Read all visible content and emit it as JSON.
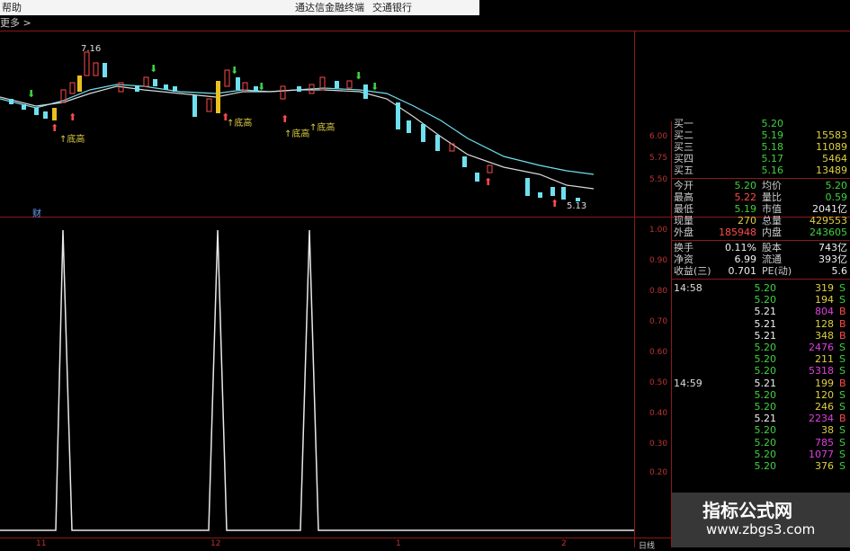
{
  "titlebar": {
    "menu": "帮助",
    "title": "通达信金融终端",
    "stock_name": "交通银行"
  },
  "subbar": {
    "more": "更多 >"
  },
  "price_axis": [
    "6.00",
    "5.75",
    "5.50"
  ],
  "indicator_axis": [
    "1.00",
    "0.90",
    "0.80",
    "0.70",
    "0.60",
    "0.50",
    "0.40",
    "0.30",
    "0.20"
  ],
  "annotations": {
    "high_price": "7.16",
    "low_price": "5.13",
    "bottom_high": "↑底高",
    "finance_tag": "财"
  },
  "bottom_bar": {
    "dates": [
      "11",
      "12",
      "1",
      "2"
    ],
    "period": "日线"
  },
  "quote": {
    "bids": [
      {
        "label": "买一",
        "price": "5.20",
        "vol": "",
        "price_color": "green"
      },
      {
        "label": "买二",
        "price": "5.19",
        "vol": "15583",
        "price_color": "green"
      },
      {
        "label": "买三",
        "price": "5.18",
        "vol": "11089",
        "price_color": "green"
      },
      {
        "label": "买四",
        "price": "5.17",
        "vol": "5464",
        "price_color": "green"
      },
      {
        "label": "买五",
        "price": "5.16",
        "vol": "13489",
        "price_color": "green"
      }
    ],
    "stats": [
      {
        "l1": "今开",
        "v1": "5.20",
        "c1": "green",
        "l2": "均价",
        "v2": "5.20",
        "c2": "green"
      },
      {
        "l1": "最高",
        "v1": "5.22",
        "c1": "red",
        "l2": "量比",
        "v2": "0.59",
        "c2": "green"
      },
      {
        "l1": "最低",
        "v1": "5.19",
        "c1": "green",
        "l2": "市值",
        "v2": "2041亿",
        "c2": "white"
      },
      {
        "l1": "现量",
        "v1": "270",
        "c1": "yellow",
        "l2": "总量",
        "v2": "429553",
        "c2": "yellow"
      },
      {
        "l1": "外盘",
        "v1": "185948",
        "c1": "red",
        "l2": "内盘",
        "v2": "243605",
        "c2": "green"
      }
    ],
    "fin": [
      {
        "l1": "换手",
        "v1": "0.11%",
        "l2": "股本",
        "v2": "743亿"
      },
      {
        "l1": "净资",
        "v1": "6.99",
        "l2": "流通",
        "v2": "393亿"
      },
      {
        "l1": "收益(三)",
        "v1": "0.701",
        "l2": "PE(动)",
        "v2": "5.6"
      }
    ],
    "ticks": [
      {
        "time": "14:58",
        "price": "5.20",
        "pc": "green",
        "vol": "319",
        "vc": "yellow",
        "bs": "S",
        "bsc": "green"
      },
      {
        "time": "",
        "price": "5.20",
        "pc": "green",
        "vol": "194",
        "vc": "yellow",
        "bs": "S",
        "bsc": "green"
      },
      {
        "time": "",
        "price": "5.21",
        "pc": "white",
        "vol": "804",
        "vc": "magenta",
        "bs": "B",
        "bsc": "red"
      },
      {
        "time": "",
        "price": "5.21",
        "pc": "white",
        "vol": "128",
        "vc": "yellow",
        "bs": "B",
        "bsc": "red"
      },
      {
        "time": "",
        "price": "5.21",
        "pc": "white",
        "vol": "348",
        "vc": "yellow",
        "bs": "B",
        "bsc": "red"
      },
      {
        "time": "",
        "price": "5.20",
        "pc": "green",
        "vol": "2476",
        "vc": "magenta",
        "bs": "S",
        "bsc": "green"
      },
      {
        "time": "",
        "price": "5.20",
        "pc": "green",
        "vol": "211",
        "vc": "yellow",
        "bs": "S",
        "bsc": "green"
      },
      {
        "time": "",
        "price": "5.20",
        "pc": "green",
        "vol": "5318",
        "vc": "magenta",
        "bs": "S",
        "bsc": "green"
      },
      {
        "time": "14:59",
        "price": "5.21",
        "pc": "white",
        "vol": "199",
        "vc": "yellow",
        "bs": "B",
        "bsc": "red"
      },
      {
        "time": "",
        "price": "5.20",
        "pc": "green",
        "vol": "120",
        "vc": "yellow",
        "bs": "S",
        "bsc": "green"
      },
      {
        "time": "",
        "price": "5.20",
        "pc": "green",
        "vol": "246",
        "vc": "yellow",
        "bs": "S",
        "bsc": "green"
      },
      {
        "time": "",
        "price": "5.21",
        "pc": "white",
        "vol": "2234",
        "vc": "magenta",
        "bs": "B",
        "bsc": "red"
      },
      {
        "time": "",
        "price": "5.20",
        "pc": "green",
        "vol": "38",
        "vc": "yellow",
        "bs": "S",
        "bsc": "green"
      },
      {
        "time": "",
        "price": "5.20",
        "pc": "green",
        "vol": "785",
        "vc": "magenta",
        "bs": "S",
        "bsc": "green"
      },
      {
        "time": "",
        "price": "5.20",
        "pc": "green",
        "vol": "1077",
        "vc": "magenta",
        "bs": "S",
        "bsc": "green"
      },
      {
        "time": "",
        "price": "5.20",
        "pc": "green",
        "vol": "376",
        "vc": "yellow",
        "bs": "S",
        "bsc": "green"
      }
    ]
  },
  "watermark": {
    "title": "指标公式网",
    "url": "www.zbgs3.com"
  },
  "colors": {
    "up": "#ff4b4b",
    "down": "#3fd23f",
    "cyan": "#6fe0f0",
    "frame": "#8a1a1a",
    "ma": "#d8d8d8"
  }
}
